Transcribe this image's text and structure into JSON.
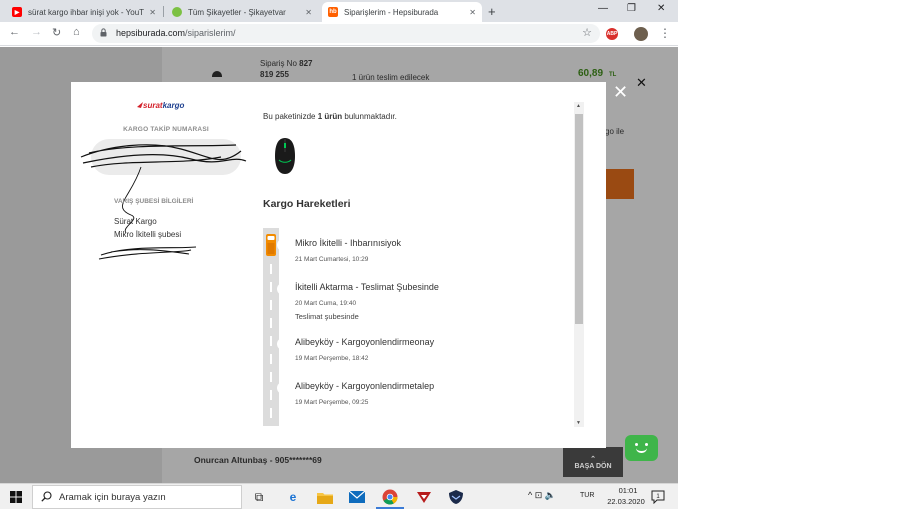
{
  "browser": {
    "tabs": [
      {
        "title": "sürat kargo ihbar inişi yok - YouT",
        "favicon": "youtube-icon",
        "active": false
      },
      {
        "title": "Tüm Şikayetler - Şikayetvar",
        "favicon": "sikayetvar-icon",
        "active": false
      },
      {
        "title": "Siparişlerim - Hepsiburada",
        "favicon": "hepsiburada-icon",
        "favicon_text": "hb",
        "active": true
      }
    ],
    "tab_close": "✕",
    "new_tab": "+",
    "window_controls": {
      "minimize": "—",
      "maximize": "❐",
      "close": "✕"
    },
    "url_host": "hepsiburada.com",
    "url_path": "/siparislerim/",
    "adblock_label": "ABP"
  },
  "background_page": {
    "order_label": "Sipariş No",
    "order_number_part1": "827",
    "order_number_part2": "819 255",
    "delivery_status": "1 ürün teslim edilecek",
    "price": "60,89",
    "currency": "TL",
    "return_label": "go ile",
    "customer": "Onurcan Altunbaş - 905*******69",
    "back_to_top_arrow": "⌃",
    "back_to_top": "BAŞA DÖN"
  },
  "modal": {
    "close": "✕",
    "logo_text_1": "surat",
    "logo_text_2": "kargo",
    "tracking_title": "KARGO TAKİP NUMARASI",
    "branch_title": "VARIŞ ŞUBESİ BİLGİLERİ",
    "branch_company": "Sürat Kargo",
    "branch_name": "Mikro İkitelli şubesi",
    "package_info_pre": "Bu paketinizde ",
    "package_info_count": "1 ürün",
    "package_info_post": " bulunmaktadır.",
    "movements_title": "Kargo Hareketleri",
    "movements": [
      {
        "place": "Mikro İkitelli - Ihbarınısiyok",
        "date": "21 Mart Cumartesi, 10:29",
        "note": ""
      },
      {
        "place": "İkitelli Aktarma - Teslimat Şubesinde",
        "date": "20 Mart Cuma, 19:40",
        "note": "Teslimat şubesinde"
      },
      {
        "place": "Alibeyköy - Kargoyonlendirmeonay",
        "date": "19 Mart Perşembe, 18:42",
        "note": ""
      },
      {
        "place": "Alibeyköy - Kargoyonlendirmetalep",
        "date": "19 Mart Perşembe, 09:25",
        "note": ""
      }
    ],
    "scroll_up": "▲",
    "scroll_down": "▼"
  },
  "taskbar": {
    "search_placeholder": "Aramak için buraya yazın",
    "tray_symbols": "^  ⊡  🔈",
    "lang": "TUR",
    "time": "01:01",
    "date": "22.03.2020",
    "notification_count": "1"
  },
  "colors": {
    "accent_orange": "#f28b00",
    "overlay_gray": "#9a9a9a",
    "chat_green": "#3fb54a",
    "brand_red": "#d3202a",
    "brand_blue": "#1d3f8f"
  }
}
